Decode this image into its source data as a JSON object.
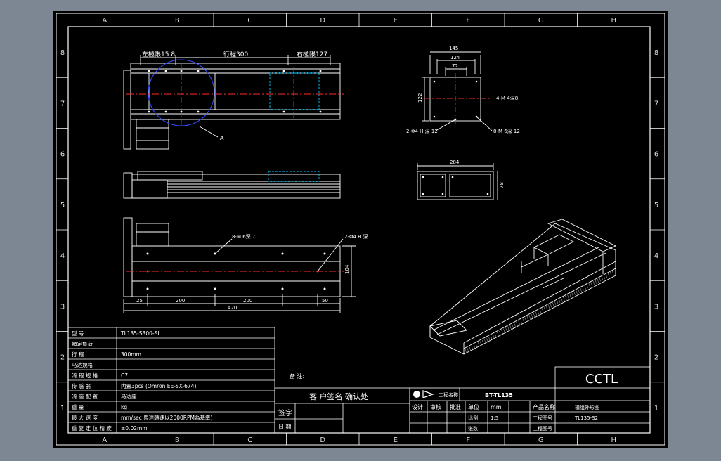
{
  "colors": {
    "background": "#7d8793",
    "sheet": "#000000",
    "line": "#ffffff",
    "center_line": "#ff2a2a",
    "circle": "#2f4cff",
    "hidden": "#00c8ff"
  },
  "grid": {
    "columns": [
      "A",
      "B",
      "C",
      "D",
      "E",
      "F",
      "G",
      "H"
    ],
    "rows": [
      "8",
      "7",
      "6",
      "5",
      "4",
      "3",
      "2",
      "1"
    ]
  },
  "top_view": {
    "left_limit": "左極限15.8",
    "stroke": "行程300",
    "right_limit": "右極限127",
    "callout": "A"
  },
  "bottom_view": {
    "holes_top": "8-M 6深 7",
    "holes_right": "2-Φ4 H 深",
    "dim_height": "104",
    "dim_left": "25",
    "dim_pitch1": "200",
    "dim_pitch2": "200",
    "dim_right": "50",
    "dim_total": "420"
  },
  "end_view": {
    "w1": "145",
    "w2": "124",
    "w3": "72",
    "h1": "122",
    "right_note": "4-M 4深8",
    "pin_note": "2-Φ4 H 深 12",
    "tap_note": "8-M 6深 12"
  },
  "motor_view": {
    "width": "284",
    "height": "78"
  },
  "spec_table": {
    "rows": [
      {
        "label": "型 号",
        "value": "TL135-S300-SL"
      },
      {
        "label": "額定負荷",
        "value": ""
      },
      {
        "label": "行 程",
        "value": "300mm"
      },
      {
        "label": "马达規格",
        "value": ""
      },
      {
        "label": "滑 程 规 格",
        "value": "C7"
      },
      {
        "label": "传 感 器",
        "value": "内置3pcs (Omron EE-SX-674)"
      },
      {
        "label": "滑 座 配 置",
        "value": "马达座"
      },
      {
        "label": "重 量",
        "value": "kg"
      },
      {
        "label": "最 大 速 度",
        "value": "mm/sec 馬達轉速以2000RPM為基準)"
      },
      {
        "label": "重 复 定 位 精 度",
        "value": "±0.02mm"
      }
    ]
  },
  "notes_label": "备 注:",
  "confirm": {
    "title": "客 户签名 确认处",
    "sign": "签字",
    "date": "日 期"
  },
  "title_block": {
    "logo_name": "工程名称",
    "drawing_name": "BT-TL135",
    "brand": "CCTL",
    "row1": [
      "设计",
      "审核",
      "批准",
      "单位",
      "mm",
      "产品名称"
    ],
    "product_name": "模组外形图",
    "row2": [
      "",
      "",
      "",
      "比例",
      "1:5",
      "工程图号"
    ],
    "drawing_no": "TL135-S2",
    "row3": [
      "",
      "",
      "",
      "张数",
      "",
      "工程图号"
    ]
  }
}
